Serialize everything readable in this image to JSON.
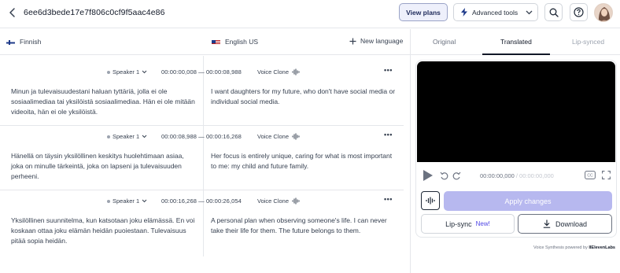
{
  "header": {
    "project_id": "6ee6d3bede17e7f806c0cf9f5aac4e86",
    "view_plans_label": "View plans",
    "advanced_tools_label": "Advanced tools"
  },
  "languages": {
    "source": "Finnish",
    "target": "English US",
    "new_language_label": "New language"
  },
  "segments": [
    {
      "speaker": "Speaker 1",
      "time": "00:00:00,008 — 00:00:08,988",
      "voice": "Voice Clone",
      "source_text": "Minun ja tulevaisuudestani haluan tyttäriä, jolla ei ole sosiaalimediaa tai yksilöistä sosiaalimediaa. Hän ei ole mitään videoita, hän ei ole yksilöistä.",
      "target_text": "I want daughters for my future, who don't have social media or individual social media."
    },
    {
      "speaker": "Speaker 1",
      "time": "00:00:08,988 — 00:00:16,268",
      "voice": "Voice Clone",
      "source_text": "Hänellä on täysin yksilöllinen keskitys huolehtimaan asiaa, joka on minulle tärkeintä, joka on lapseni ja tulevaisuuden perheeni.",
      "target_text": "Her focus is entirely unique, caring for what is most important to me: my child and future family."
    },
    {
      "speaker": "Speaker 1",
      "time": "00:00:16,268 — 00:00:26,054",
      "voice": "Voice Clone",
      "source_text": "Yksilöllinen suunnitelma, kun katsotaan joku elämässä. En voi koskaan ottaa joku elämän heidän puoiestaan. Tulevaisuus pitää sopia heidän.",
      "target_text": "A personal plan when observing someone's life. I can never take their life for them. The future belongs to them."
    }
  ],
  "panel": {
    "tabs": [
      "Original",
      "Translated",
      "Lip-synced"
    ],
    "active_tab": "Translated",
    "time_current": "00:00:00,000",
    "time_total": "/ 00:00:00,000",
    "apply_label": "Apply changes",
    "lipsync_label": "Lip-sync",
    "lipsync_badge": "New!",
    "download_label": "Download",
    "powered_prefix": "Voice Synthesis powered by",
    "powered_brand": "IIElevenLabs"
  },
  "colors": {
    "accent": "#b7b8ef",
    "new_badge": "#4f46e5",
    "view_plans_bg": "#eef0fb"
  },
  "icons": {
    "back": "chevron-left-icon",
    "advanced": "lightning-icon",
    "search": "search-icon",
    "help": "help-icon",
    "add": "plus-icon",
    "more": "more-horizontal-icon",
    "voice": "waveform-icon",
    "play": "play-icon",
    "undo": "undo-icon",
    "redo": "redo-icon",
    "captions": "captions-icon",
    "fullscreen": "fullscreen-icon",
    "download": "download-icon"
  }
}
